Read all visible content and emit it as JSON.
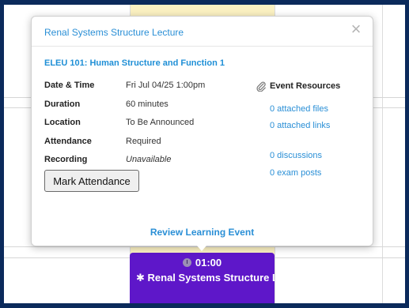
{
  "popover": {
    "title": "Renal Systems Structure Lecture",
    "close_label": "×",
    "course_link": "ELEU 101: Human Structure and Function 1",
    "details": [
      {
        "label": "Date & Time",
        "value": "Fri Jul 04/25 1:00pm"
      },
      {
        "label": "Duration",
        "value": "60 minutes"
      },
      {
        "label": "Location",
        "value": "To Be Announced"
      },
      {
        "label": "Attendance",
        "value": "Required"
      },
      {
        "label": "Recording",
        "value": "Unavailable"
      }
    ],
    "mark_attendance_label": "Mark Attendance",
    "resources": {
      "heading": "Event Resources",
      "icon": "paperclip-icon",
      "links": [
        "0 attached files",
        "0 attached links",
        "0 discussions",
        "0 exam posts"
      ]
    },
    "review_link": "Review Learning Event"
  },
  "calendar_event": {
    "time": "01:00",
    "title": "✱ Renal Systems Structure Lecture",
    "color": "#5e17c9",
    "icon": "clock-icon"
  },
  "colors": {
    "frame": "#0b2a5b",
    "link": "#2a8fd6",
    "today_column": "#fbf1c2"
  }
}
